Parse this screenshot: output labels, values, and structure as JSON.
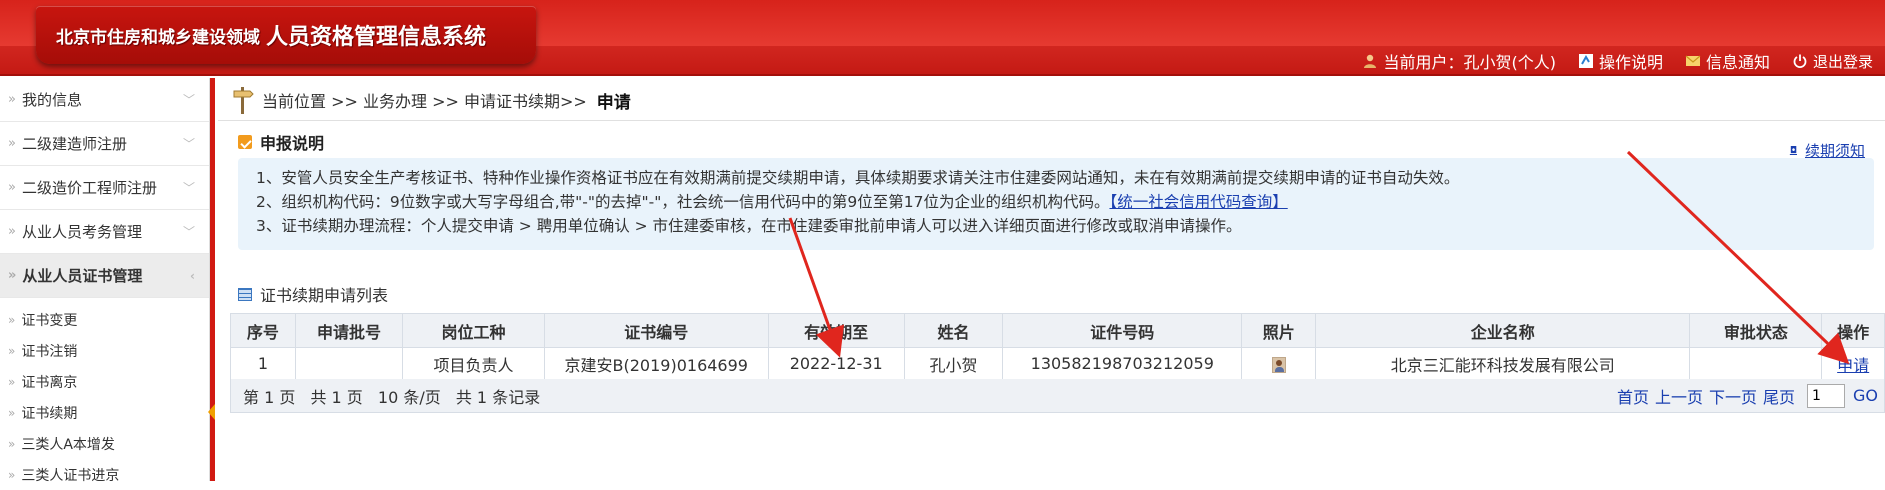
{
  "header": {
    "org": "北京市住房和城乡建设领域",
    "system": "人员资格管理信息系统",
    "current_user": "当前用户：孔小贺(个人)",
    "help": "操作说明",
    "notify": "信息通知",
    "logout": "退出登录"
  },
  "sidebar": {
    "groups": [
      {
        "label": "我的信息"
      },
      {
        "label": "二级建造师注册"
      },
      {
        "label": "二级造价工程师注册"
      },
      {
        "label": "从业人员考务管理"
      },
      {
        "label": "从业人员证书管理"
      }
    ],
    "subitems": [
      {
        "label": "证书变更"
      },
      {
        "label": "证书注销"
      },
      {
        "label": "证书离京"
      },
      {
        "label": "证书续期"
      },
      {
        "label": "三类人A本增发"
      },
      {
        "label": "三类人证书进京"
      }
    ]
  },
  "breadcrumb": {
    "path": "当前位置 >> 业务办理 >> 申请证书续期>>",
    "current": "申请"
  },
  "notice": {
    "title": "申报说明",
    "renew_link": "续期须知",
    "line1": "1、安管人员安全生产考核证书、特种作业操作资格证书应在有效期满前提交续期申请，具体续期要求请关注市住建委网站通知，未在有效期满前提交续期申请的证书自动失效。",
    "line2": "2、组织机构代码：9位数字或大写字母组合,带\"-\"的去掉\"-\"，社会统一信用代码中的第9位至第17位为企业的组织机构代码。",
    "line2_link": "【统一社会信用代码查询】",
    "line3": "3、证书续期办理流程：个人提交申请 > 聘用单位确认 > 市住建委审核，在市住建委审批前申请人可以进入详细页面进行修改或取消申请操作。"
  },
  "list": {
    "title": "证书续期申请列表",
    "columns": [
      "序号",
      "申请批号",
      "岗位工种",
      "证书编号",
      "有效期至",
      "姓名",
      "证件号码",
      "照片",
      "企业名称",
      "审批状态",
      "操作"
    ],
    "rows": [
      {
        "no": "1",
        "batch": "",
        "job": "项目负责人",
        "cert_no": "京建安B(2019)0164699",
        "valid_until": "2022-12-31",
        "name": "孔小贺",
        "id_no": "130582198703212059",
        "company": "北京三汇能环科技发展有限公司",
        "status": "",
        "action": "申请"
      }
    ]
  },
  "pager": {
    "page": "第 1 页",
    "total_pages": "共 1 页",
    "per_page": "10 条/页",
    "total_records": "共 1 条记录",
    "first": "首页",
    "prev": "上一页",
    "next": "下一页",
    "last": "尾页",
    "page_input": "1",
    "go": "GO"
  },
  "colors": {
    "header_red": "#d11a12",
    "link_blue": "#1a3fb0",
    "notice_bg": "#e9f3fb",
    "annotation_red": "#e0261e"
  }
}
